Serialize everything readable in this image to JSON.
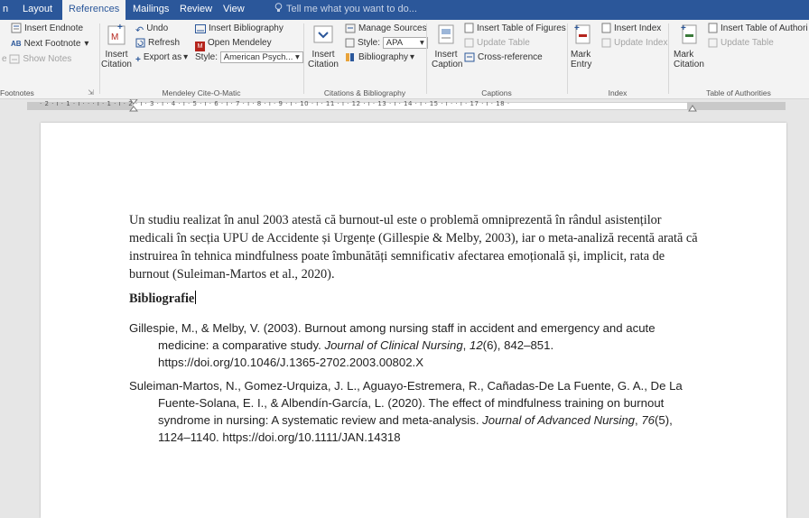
{
  "tabs": [
    {
      "label": "n",
      "active": false
    },
    {
      "label": "Layout",
      "active": false
    },
    {
      "label": "References",
      "active": true
    },
    {
      "label": "Mailings",
      "active": false
    },
    {
      "label": "Review",
      "active": false
    },
    {
      "label": "View",
      "active": false
    }
  ],
  "tell_me": "Tell me what you want to do...",
  "ribbon": {
    "footnotes": {
      "insert_endnote": "Insert Endnote",
      "next_footnote": "Next Footnote",
      "show_notes": "Show Notes",
      "left_clip": "e",
      "group": "Footnotes"
    },
    "mendeley": {
      "insert_citation": "Insert Citation",
      "undo": "Undo",
      "refresh": "Refresh",
      "export_as": "Export as",
      "insert_bibliography": "Insert Bibliography",
      "open_mendeley": "Open Mendeley",
      "style_label": "Style:",
      "style_value": "American Psych...",
      "group": "Mendeley Cite-O-Matic"
    },
    "citations": {
      "insert_citation": "Insert Citation",
      "manage_sources": "Manage Sources",
      "style_label": "Style:",
      "style_value": "APA",
      "bibliography": "Bibliography",
      "group": "Citations & Bibliography"
    },
    "captions": {
      "insert_caption": "Insert Caption",
      "insert_table_of_figures": "Insert Table of Figures",
      "update_table": "Update Table",
      "cross_reference": "Cross-reference",
      "group": "Captions"
    },
    "index": {
      "mark_entry": "Mark Entry",
      "insert_index": "Insert Index",
      "update_index": "Update Index",
      "group": "Index"
    },
    "authorities": {
      "mark_citation": "Mark Citation",
      "insert_table": "Insert Table of Authori",
      "update_table": "Update Table",
      "group": "Table of Authorities"
    }
  },
  "ruler_text": "· 2 · ı · 1 · ı ·  ·  · ı · 1 · ı · 2 · ı · 3 · ı · 4 · ı · 5 · ı · 6 · ı · 7 · ı · 8 · ı · 9 · ı · 10 · ı · 11 · ı · 12 · ı · 13 · ı · 14 · ı · 15 · ı ·  · ı · 17 · ı · 18 ·",
  "document": {
    "paragraph": "Un studiu realizat în anul 2003 atestă că burnout-ul este o problemă omniprezentă în rândul asistenților medicali în secția UPU de Accidente și Urgențe (Gillespie & Melby, 2003), iar o meta-analiză recentă arată că instruirea în tehnica mindfulness poate îmbunătăți semnificativ afectarea emoțională și, implicit, rata de burnout (Suleiman-Martos et al., 2020).",
    "heading": "Bibliografie",
    "ref1": {
      "pre": "Gillespie, M., & Melby, V. (2003). Burnout among nursing staff in accident and emergency and acute medicine: a comparative study. ",
      "journal": "Journal of Clinical Nursing",
      "sep": ", ",
      "volume": "12",
      "post": "(6), 842–851. https://doi.org/10.1046/J.1365-2702.2003.00802.X"
    },
    "ref2": {
      "pre": "Suleiman-Martos, N., Gomez-Urquiza, J. L., Aguayo-Estremera, R., Cañadas-De La Fuente, G. A., De La Fuente-Solana, E. I., & Albendín-García, L. (2020). The effect of mindfulness training on burnout syndrome in nursing: A systematic review and meta-analysis. ",
      "journal": "Journal of Advanced Nursing",
      "sep": ", ",
      "volume": "76",
      "post": "(5), 1124–1140. https://doi.org/10.1111/JAN.14318"
    }
  }
}
